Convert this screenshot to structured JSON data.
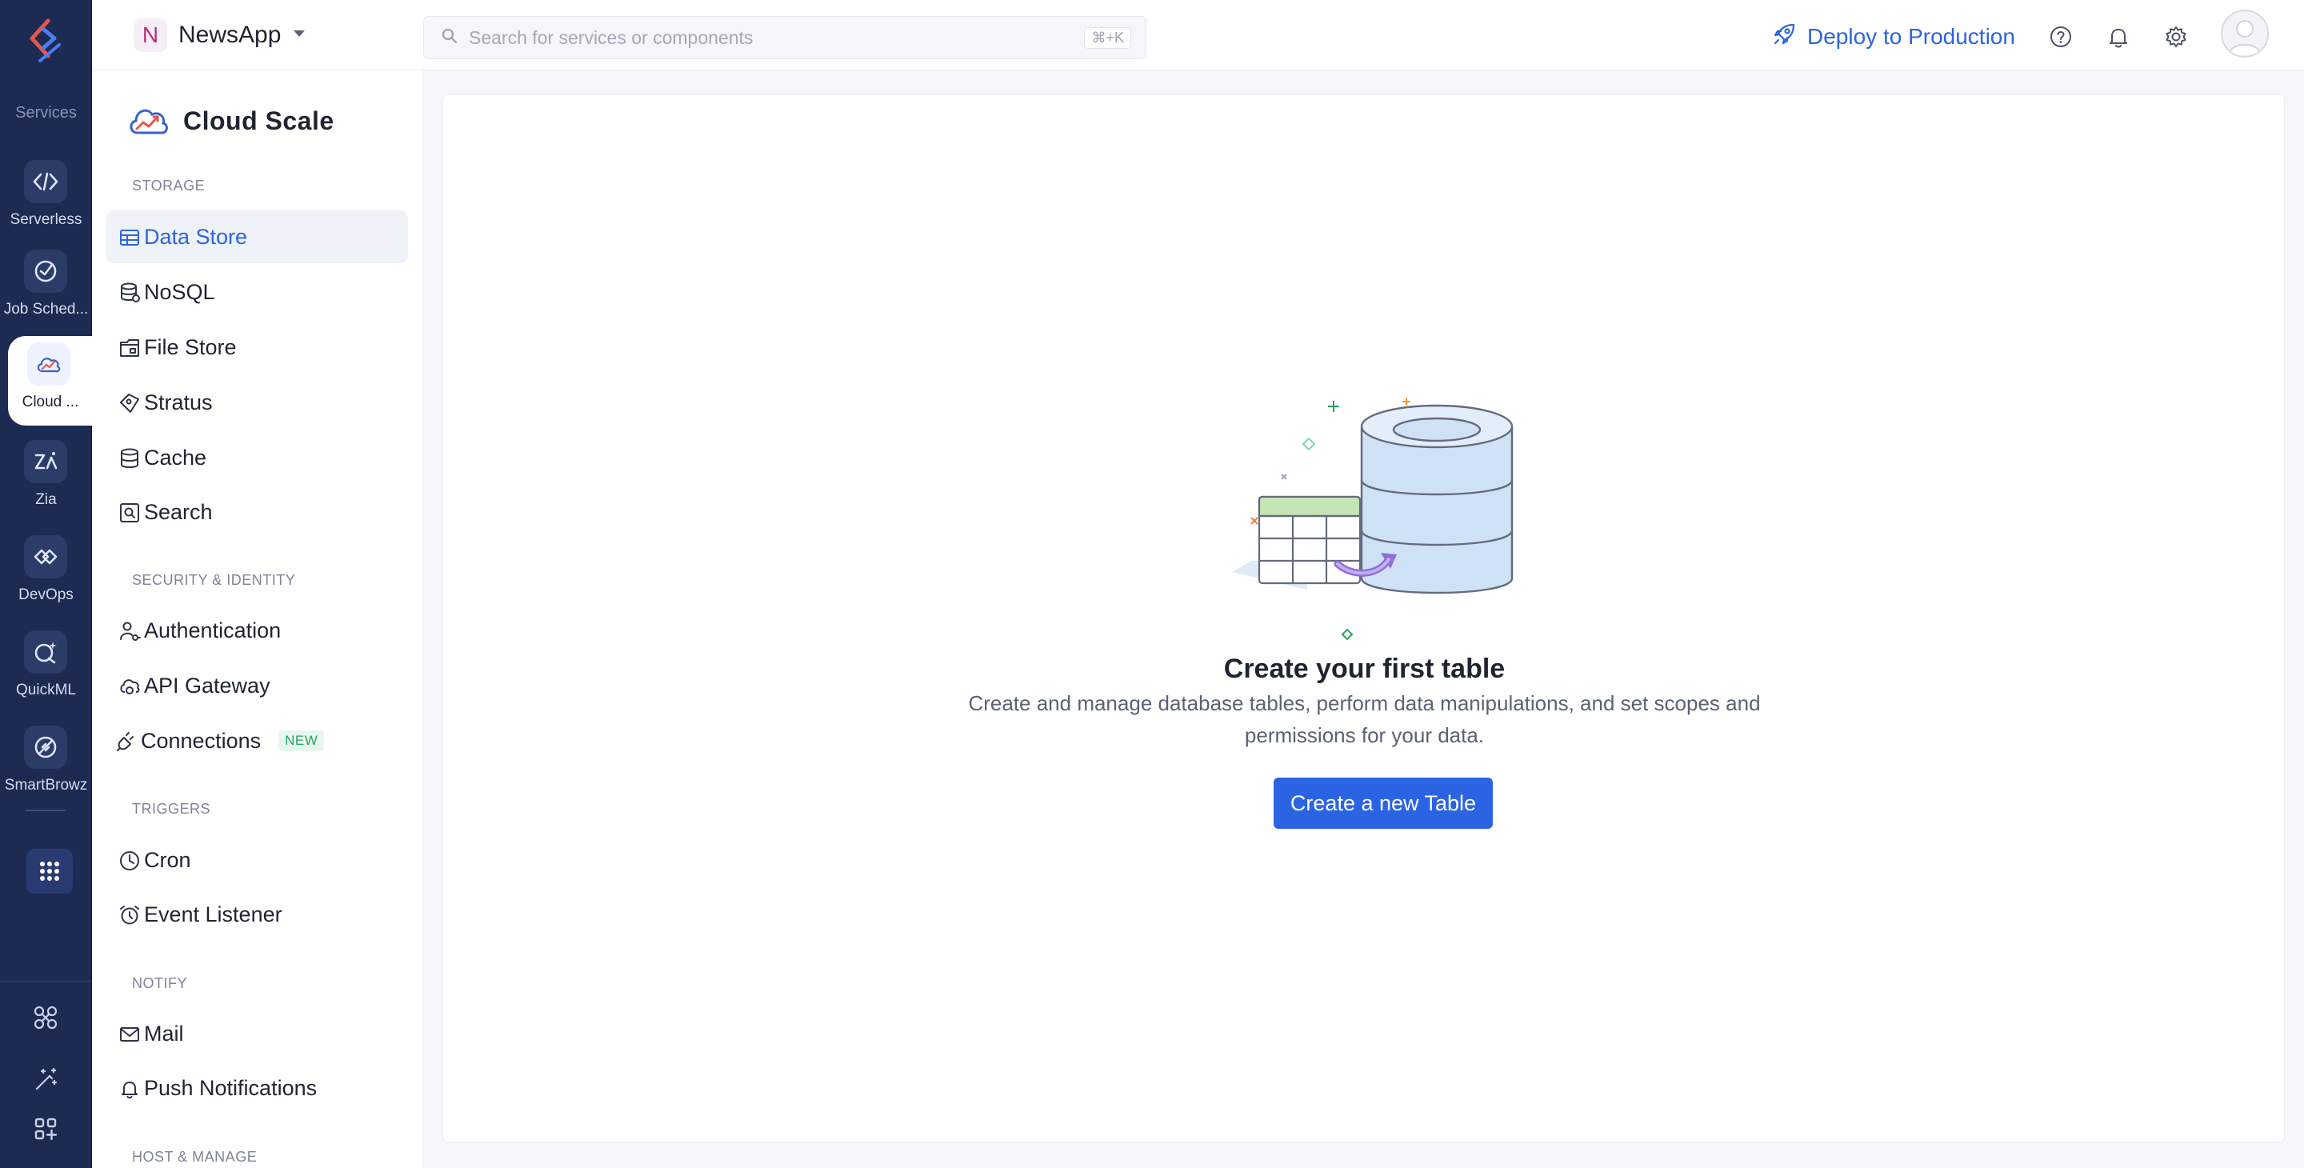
{
  "colors": {
    "rail_bg": "#1d2a52",
    "accent": "#2b64e3",
    "active_bg": "#eff2f8",
    "new_badge": "#27a35b"
  },
  "rail": {
    "heading": "Services",
    "items": [
      {
        "label": "Serverless",
        "icon": "serverless-icon"
      },
      {
        "label": "Job Sched...",
        "icon": "job-scheduling-icon"
      },
      {
        "label": "Cloud ...",
        "icon": "cloud-scale-icon",
        "active": true
      },
      {
        "label": "Zia",
        "icon": "zia-icon"
      },
      {
        "label": "DevOps",
        "icon": "devops-icon"
      },
      {
        "label": "QuickML",
        "icon": "quickml-icon"
      },
      {
        "label": "SmartBrowz",
        "icon": "smartbrowz-icon"
      }
    ],
    "bottom_icons": [
      "integrations-icon",
      "magic-wand-icon",
      "add-widget-icon"
    ]
  },
  "topbar": {
    "project_initial": "N",
    "project_name": "NewsApp",
    "search_placeholder": "Search for services or components",
    "search_shortcut": "⌘+K",
    "deploy_label": "Deploy to Production",
    "icons": [
      "help-icon",
      "bell-icon",
      "gear-icon"
    ]
  },
  "sidebar": {
    "title": "Cloud Scale",
    "sections": [
      {
        "heading": "STORAGE",
        "items": [
          {
            "label": "Data Store",
            "icon": "table-icon",
            "active": true
          },
          {
            "label": "NoSQL",
            "icon": "nosql-icon"
          },
          {
            "label": "File Store",
            "icon": "folder-icon"
          },
          {
            "label": "Stratus",
            "icon": "bucket-icon"
          },
          {
            "label": "Cache",
            "icon": "database-icon"
          },
          {
            "label": "Search",
            "icon": "search-box-icon"
          }
        ]
      },
      {
        "heading": "SECURITY & IDENTITY",
        "items": [
          {
            "label": "Authentication",
            "icon": "user-key-icon"
          },
          {
            "label": "API Gateway",
            "icon": "gateway-icon"
          },
          {
            "label": "Connections",
            "icon": "plug-icon",
            "badge": "NEW"
          }
        ]
      },
      {
        "heading": "TRIGGERS",
        "items": [
          {
            "label": "Cron",
            "icon": "clock-icon"
          },
          {
            "label": "Event Listener",
            "icon": "alarm-icon"
          }
        ]
      },
      {
        "heading": "NOTIFY",
        "items": [
          {
            "label": "Mail",
            "icon": "mail-icon"
          },
          {
            "label": "Push Notifications",
            "icon": "bell-icon"
          }
        ]
      },
      {
        "heading": "HOST & MANAGE",
        "items": []
      }
    ]
  },
  "main": {
    "empty_title": "Create your first table",
    "empty_description": "Create and manage database tables, perform data manipulations, and set scopes and permissions for your data.",
    "create_button": "Create a new Table"
  }
}
